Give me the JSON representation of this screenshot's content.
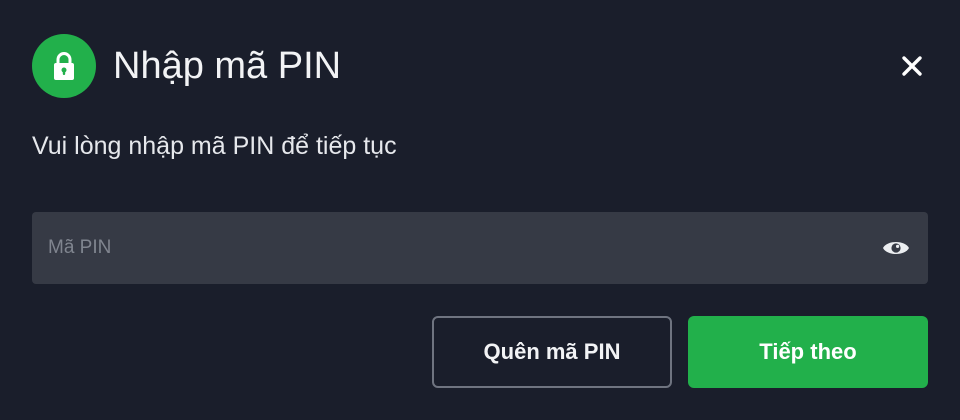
{
  "dialog": {
    "title": "Nhập mã PIN",
    "subtitle": "Vui lòng nhập mã PIN để tiếp tục",
    "icons": {
      "header": "lock-icon",
      "close": "close-icon",
      "visibility": "eye-icon"
    }
  },
  "pin_field": {
    "value": "",
    "placeholder": "Mã PIN"
  },
  "actions": {
    "forgot_label": "Quên mã PIN",
    "next_label": "Tiếp theo"
  },
  "colors": {
    "background": "#1a1e2b",
    "accent": "#22b04b",
    "field": "#363a45",
    "secondary_border": "#6f7480"
  }
}
